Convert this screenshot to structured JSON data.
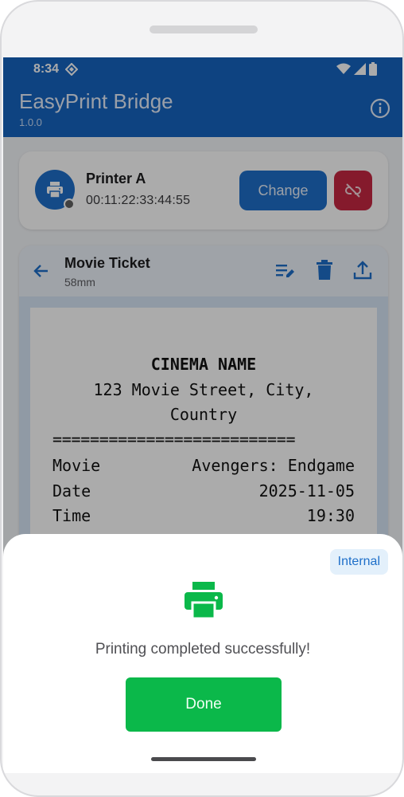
{
  "status_bar": {
    "time": "8:34"
  },
  "app_bar": {
    "title": "EasyPrint Bridge",
    "version": "1.0.0"
  },
  "printer": {
    "name": "Printer A",
    "mac": "00:11:22:33:44:55",
    "change_label": "Change"
  },
  "ticket": {
    "title": "Movie Ticket",
    "paper_size": "58mm",
    "receipt": {
      "header": "CINEMA NAME",
      "address_line1": "123 Movie Street, City,",
      "address_line2": "Country",
      "divider": "==========================",
      "rows": [
        {
          "label": "Movie",
          "value": "Avengers: Endgame"
        },
        {
          "label": "Date",
          "value": "2025-11-05"
        },
        {
          "label": "Time",
          "value": "19:30"
        }
      ]
    }
  },
  "dialog": {
    "badge": "Internal",
    "message": "Printing completed successfully!",
    "done_label": "Done"
  },
  "colors": {
    "primary": "#1565c0",
    "danger": "#c62842",
    "success": "#0bb84a"
  },
  "icons": [
    "wifi-icon",
    "signal-icon",
    "battery-icon",
    "info-icon",
    "printer-icon",
    "link-off-icon",
    "back-arrow-icon",
    "edit-list-icon",
    "trash-icon",
    "upload-icon"
  ]
}
